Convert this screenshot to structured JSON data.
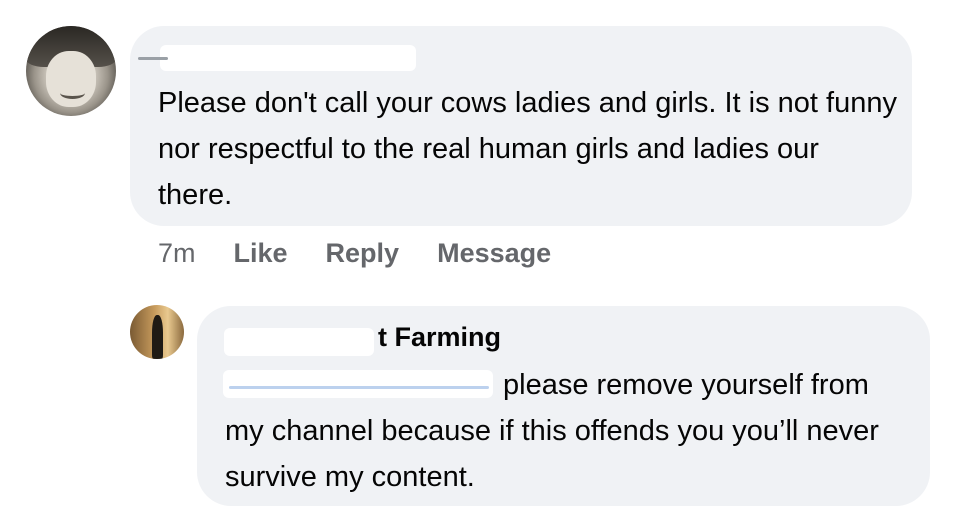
{
  "comment": {
    "text": "Please don't call your cows ladies and girls. It is not funny nor respectful to the real human girls and ladies our there.",
    "time": "7m",
    "actions": [
      "Like",
      "Reply",
      "Message"
    ]
  },
  "reply": {
    "author_visible": "t Farming",
    "text": "please remove yourself from my channel because if this offends you you’ll never survive my content."
  }
}
